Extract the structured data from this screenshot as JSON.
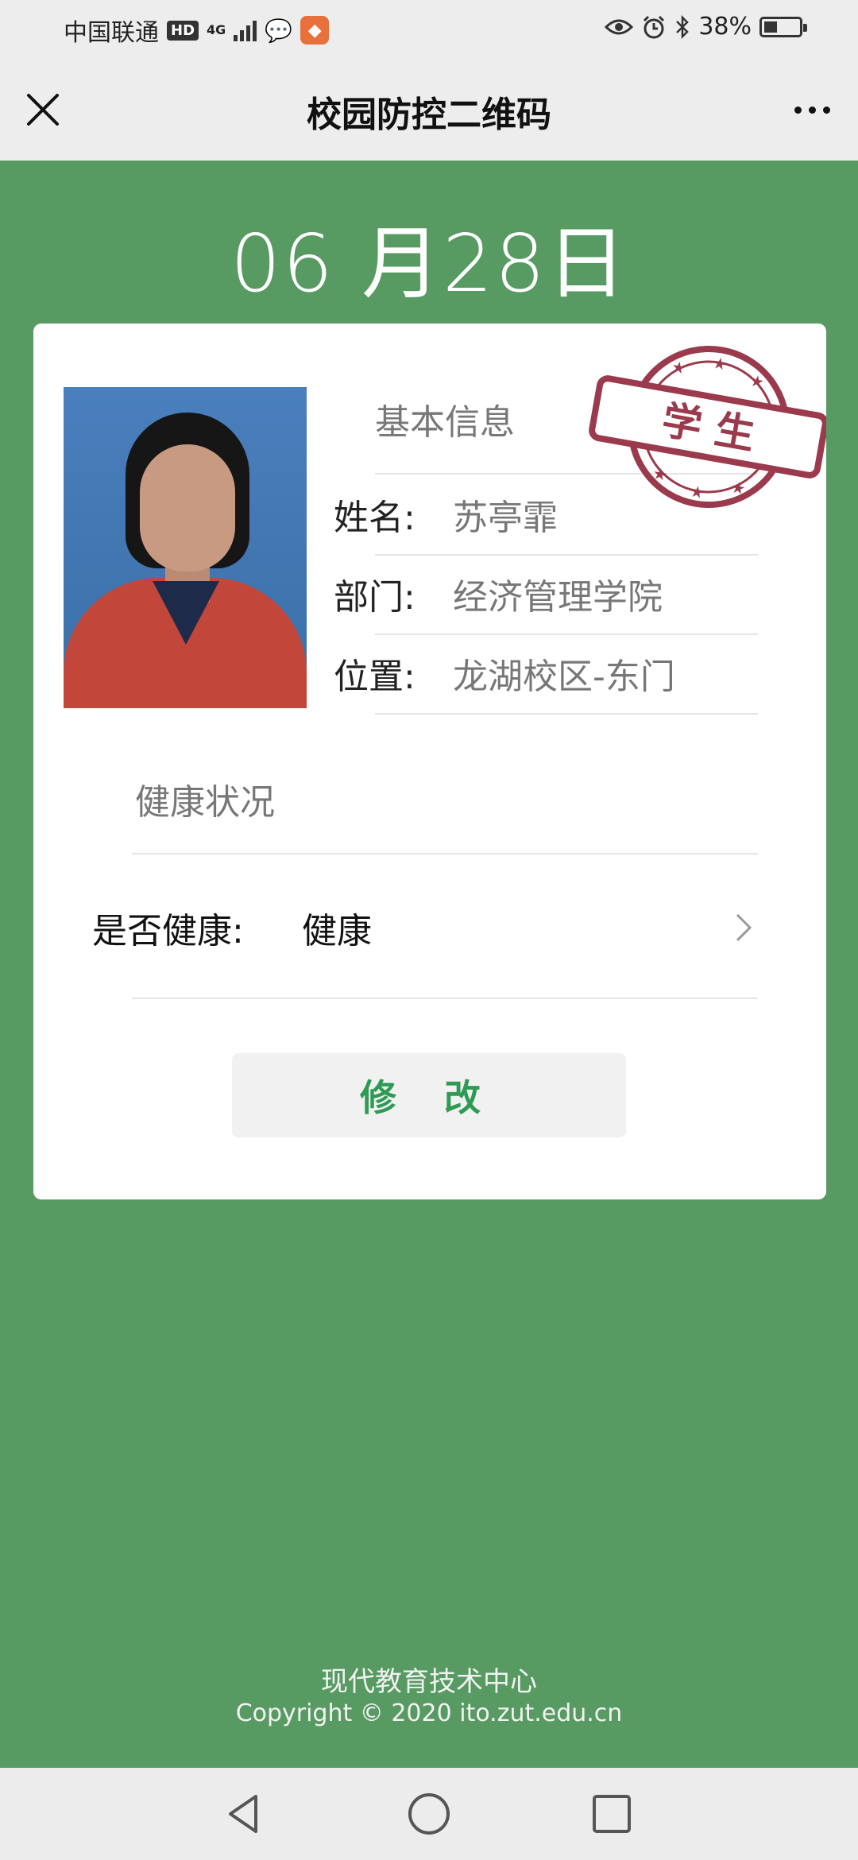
{
  "status_bar": {
    "carrier": "中国联通",
    "hd": "HD",
    "network": "4G",
    "battery_percent_text": "38%",
    "battery_level": 0.38,
    "icons": [
      "signal-icon",
      "wechat-icon",
      "app-fox-icon",
      "eye-icon",
      "alarm-icon",
      "bluetooth-icon",
      "battery-icon"
    ]
  },
  "header": {
    "title": "校园防控二维码",
    "close_icon": "close-icon",
    "more_icon": "more-icon"
  },
  "date": "06 月28日",
  "card": {
    "basic_info_title": "基本信息",
    "stamp_text": "学  生",
    "fields": [
      {
        "label": "姓名:",
        "value": "苏亭霏"
      },
      {
        "label": "部门:",
        "value": "经济管理学院"
      },
      {
        "label": "位置:",
        "value": "龙湖校区-东门"
      }
    ],
    "health_title": "健康状况",
    "health_label": "是否健康:",
    "health_value": "健康",
    "modify_button": "修 改"
  },
  "footer": {
    "line1": "现代教育技术中心",
    "line2": "Copyright © 2020 ito.zut.edu.cn"
  },
  "colors": {
    "background": "#579a62",
    "accent_green": "#2e9b55",
    "stamp": "#9b3a4d"
  }
}
